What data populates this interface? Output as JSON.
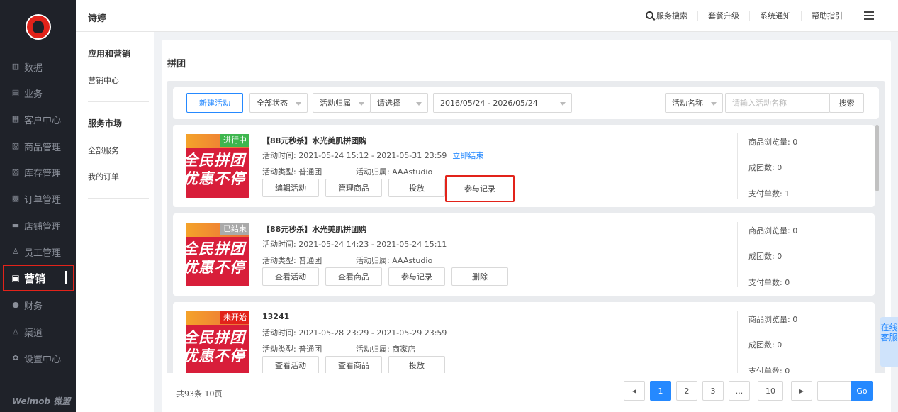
{
  "brand": "Weimob 微盟",
  "nav": {
    "items": [
      {
        "icon": "chart-icon",
        "glyph": "▥",
        "label": "数据"
      },
      {
        "icon": "briefcase-icon",
        "glyph": "▤",
        "label": "业务"
      },
      {
        "icon": "customer-icon",
        "glyph": "▦",
        "label": "客户中心"
      },
      {
        "icon": "goods-icon",
        "glyph": "▧",
        "label": "商品管理"
      },
      {
        "icon": "inventory-icon",
        "glyph": "▨",
        "label": "库存管理"
      },
      {
        "icon": "order-icon",
        "glyph": "▩",
        "label": "订单管理"
      },
      {
        "icon": "store-icon",
        "glyph": "▬",
        "label": "店铺管理"
      },
      {
        "icon": "staff-icon",
        "glyph": "♙",
        "label": "员工管理"
      },
      {
        "icon": "gift-icon",
        "glyph": "▣",
        "label": "营销"
      },
      {
        "icon": "finance-icon",
        "glyph": "●",
        "label": "财务"
      },
      {
        "icon": "channel-icon",
        "glyph": "△",
        "label": "渠道"
      },
      {
        "icon": "settings-icon",
        "glyph": "✿",
        "label": "设置中心"
      }
    ]
  },
  "topbar": {
    "shop_name": "诗婷",
    "service_search": "服务搜索",
    "upgrade": "套餐升级",
    "notice": "系统通知",
    "help": "帮助指引"
  },
  "subnav": {
    "group1": "应用和营销",
    "item1": "营销中心",
    "group2": "服务市场",
    "item2": "全部服务",
    "item3": "我的订单"
  },
  "page": {
    "title": "拼团"
  },
  "filters": {
    "new_activity": "新建活动",
    "status": "全部状态",
    "owner_label": "活动归属",
    "owner_value": "请选择",
    "date_range": "2016/05/24 - 2026/05/24",
    "name_field": "活动名称",
    "name_placeholder": "请输入活动名称",
    "search": "搜索"
  },
  "thumb_text": "全民拼团 优惠不停",
  "cards": [
    {
      "badge": "进行中",
      "title": "【88元秒杀】水光美肌拼团购",
      "time": "活动时间: 2021-05-24 15:12 - 2021-05-31 23:59",
      "end_link": "立即结束",
      "type": "活动类型: 普通团",
      "owner": "活动归属: AAAstudio",
      "buttons": [
        "编辑活动",
        "管理商品",
        "投放",
        "参与记录"
      ],
      "views": "商品浏览量: 0",
      "groups": "成团数: 0",
      "paid": "支付单数: 1"
    },
    {
      "badge": "已结束",
      "title": "【88元秒杀】水光美肌拼团购",
      "time": "活动时间: 2021-05-24 14:23 - 2021-05-24 15:11",
      "type": "活动类型: 普通团",
      "owner": "活动归属: AAAstudio",
      "buttons": [
        "查看活动",
        "查看商品",
        "参与记录",
        "删除"
      ],
      "views": "商品浏览量: 0",
      "groups": "成团数: 0",
      "paid": "支付单数: 0"
    },
    {
      "badge": "未开始",
      "title": "13241",
      "time": "活动时间: 2021-05-28 23:29 - 2021-05-29 23:59",
      "type": "活动类型: 普通团",
      "owner": "活动归属: 商家店",
      "buttons": [
        "查看活动",
        "查看商品",
        "投放"
      ],
      "views": "商品浏览量: 0",
      "groups": "成团数: 0",
      "paid": "支付单数: 0"
    }
  ],
  "pager": {
    "total": "共93条 10页",
    "pages": [
      "1",
      "2",
      "3",
      "...",
      "10"
    ],
    "go": "Go"
  },
  "online_service": "在线客服"
}
